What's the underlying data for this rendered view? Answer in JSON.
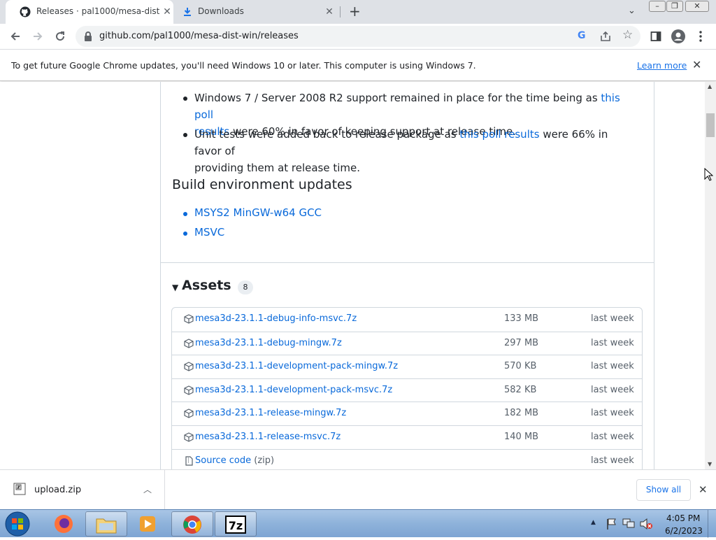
{
  "tabs": [
    {
      "title": "Releases · pal1000/mesa-dist-win",
      "icon": "github-icon",
      "active": true
    },
    {
      "title": "Downloads",
      "icon": "download-icon",
      "active": false
    }
  ],
  "toolbar": {
    "url": "github.com/pal1000/mesa-dist-win/releases"
  },
  "infobar": {
    "message": "To get future Google Chrome updates, you'll need Windows 10 or later. This computer is using Windows 7.",
    "link": "Learn more"
  },
  "content": {
    "bullet1": {
      "pre": "Windows 7 / Server 2008 R2 support remained in place for the time being as ",
      "link_a": "this poll",
      "link_b": "results",
      "post": " were 60% in favor of keeping support at release time."
    },
    "bullet2": {
      "pre": "Unit tests were added back to release package as ",
      "link": "this poll results",
      "post_a": " were 66% in favor of",
      "post_b": "providing them at release time."
    },
    "build_heading": "Build environment updates",
    "build_items": [
      "MSYS2 MinGW-w64 GCC",
      "MSVC"
    ]
  },
  "assets": {
    "title": "Assets",
    "count": "8",
    "items": [
      {
        "name": "mesa3d-23.1.1-debug-info-msvc.7z",
        "size": "133 MB",
        "date": "last week"
      },
      {
        "name": "mesa3d-23.1.1-debug-mingw.7z",
        "size": "297 MB",
        "date": "last week"
      },
      {
        "name": "mesa3d-23.1.1-development-pack-mingw.7z",
        "size": "570 KB",
        "date": "last week"
      },
      {
        "name": "mesa3d-23.1.1-development-pack-msvc.7z",
        "size": "582 KB",
        "date": "last week"
      },
      {
        "name": "mesa3d-23.1.1-release-mingw.7z",
        "size": "182 MB",
        "date": "last week"
      },
      {
        "name": "mesa3d-23.1.1-release-msvc.7z",
        "size": "140 MB",
        "date": "last week"
      }
    ],
    "source": {
      "name": "Source code",
      "suffix": "(zip)",
      "date": "last week"
    }
  },
  "downloads": {
    "file": "upload.zip",
    "show_all": "Show all"
  },
  "taskbar": {
    "time": "4:05 PM",
    "date": "6/2/2023"
  }
}
